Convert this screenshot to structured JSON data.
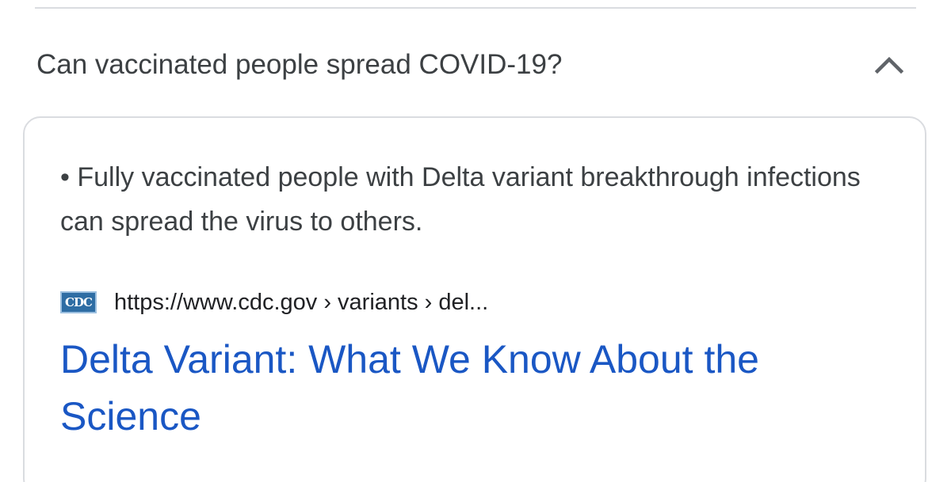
{
  "faq": {
    "question": "Can vaccinated people spread COVID-19?",
    "expanded_icon": "chevron-up-icon"
  },
  "answer": {
    "snippet": "• Fully vaccinated people with Delta variant breakthrough infections can spread the virus to others.",
    "source": {
      "favicon_text": "CDC",
      "url": "https://www.cdc.gov › variants › del..."
    },
    "title": "Delta Variant: What We Know About the Science"
  },
  "colors": {
    "link": "#1a57c4",
    "text": "#3c4043",
    "border": "#dadce0"
  }
}
